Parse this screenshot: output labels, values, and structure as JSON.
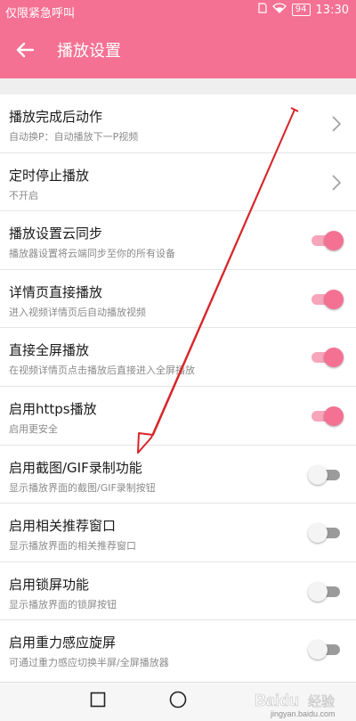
{
  "status_bar": {
    "carrier": "仅限紧急呼叫",
    "battery": "94",
    "time": "13:30"
  },
  "app_bar": {
    "title": "播放设置",
    "back_icon": "arrow-back-icon"
  },
  "colors": {
    "accent": "#f47193",
    "accent_light": "#f7a5bb",
    "switch_off_track": "#9b9b9b",
    "divider": "#e5e5e5"
  },
  "settings": [
    {
      "label": "播放完成后动作",
      "sub": "自动换P：自动播放下一P视频",
      "control": "chevron"
    },
    {
      "label": "定时停止播放",
      "sub": "不开启",
      "control": "chevron"
    },
    {
      "label": "播放设置云同步",
      "sub": "播放器设置将云端同步至你的所有设备",
      "control": "switch",
      "on": true
    },
    {
      "label": "详情页直接播放",
      "sub": "进入视频详情页后自动播放视频",
      "control": "switch",
      "on": true
    },
    {
      "label": "直接全屏播放",
      "sub": "在视频详情页点击播放后直接进入全屏播放",
      "control": "switch",
      "on": true
    },
    {
      "label": "启用https播放",
      "sub": "启用更安全",
      "control": "switch",
      "on": true
    },
    {
      "label": "启用截图/GIF录制功能",
      "sub": "显示播放界面的截图/GIF录制按钮",
      "control": "switch",
      "on": false
    },
    {
      "label": "启用相关推荐窗口",
      "sub": "显示播放界面的相关推荐窗口",
      "control": "switch",
      "on": false
    },
    {
      "label": "启用锁屏功能",
      "sub": "显示播放界面的锁屏按钮",
      "control": "switch",
      "on": false
    },
    {
      "label": "启用重力感应旋屏",
      "sub": "可通过重力感应切换半屏/全屏播放器",
      "control": "switch",
      "on": false
    }
  ],
  "watermark": {
    "brand": "Baidu",
    "text": "经验",
    "url": "jingyan.baidu.com"
  }
}
